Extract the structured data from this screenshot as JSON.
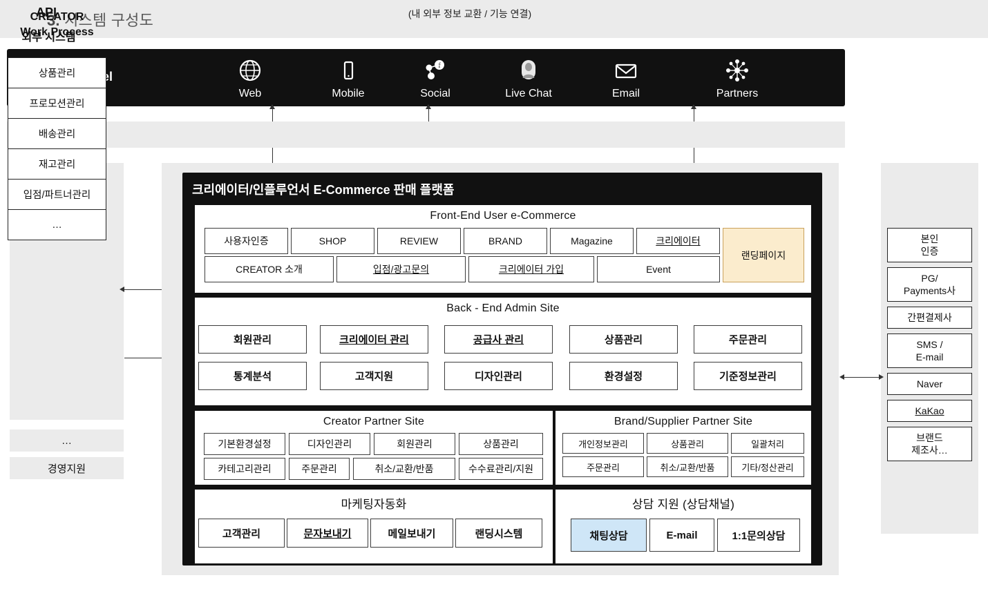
{
  "header": {
    "number": "3.",
    "title": "시스템 구성도"
  },
  "omni": {
    "label": "Omni-Channel",
    "items": [
      {
        "label": "Web",
        "icon": "globe-icon"
      },
      {
        "label": "Mobile",
        "icon": "mobile-phone-icon"
      },
      {
        "label": "Social",
        "icon": "social-network-icon"
      },
      {
        "label": "Live Chat",
        "icon": "live-chat-icon"
      },
      {
        "label": "Email",
        "icon": "envelope-icon"
      },
      {
        "label": "Partners",
        "icon": "partners-network-icon"
      }
    ]
  },
  "api": {
    "label": "API",
    "note": "(내 외부 정보 교환 /  기능 연결)"
  },
  "left_panel": {
    "title_line1": "CREATOR",
    "title_line2": "Work Process",
    "items": [
      "상품관리",
      "프로모션관리",
      "배송관리",
      "재고관리",
      "입점/파트너관리",
      "…"
    ],
    "extra1": "…",
    "extra2": "경영지원"
  },
  "right_panel": {
    "title": "외부 시스템",
    "items": [
      {
        "label": "본인\n인증",
        "underline": false,
        "tall": true
      },
      {
        "label": "PG/\nPayments사",
        "underline": false,
        "tall": true
      },
      {
        "label": "간편결제사",
        "underline": false,
        "tall": false
      },
      {
        "label": "SMS /\nE-mail",
        "underline": false,
        "tall": true
      },
      {
        "label": "Naver",
        "underline": false,
        "tall": false
      },
      {
        "label": "KaKao",
        "underline": true,
        "tall": false
      },
      {
        "label": "브랜드\n제조사…",
        "underline": false,
        "tall": true
      }
    ]
  },
  "platform": {
    "title": "크리에이터/인플루언서 E-Commerce 판매 플랫폼",
    "frontend": {
      "title": "Front-End  User e-Commerce",
      "row1": [
        {
          "label": "사용자인증",
          "underline": false,
          "highlight": "none"
        },
        {
          "label": "SHOP",
          "underline": false,
          "highlight": "none"
        },
        {
          "label": "REVIEW",
          "underline": false,
          "highlight": "none"
        },
        {
          "label": "BRAND",
          "underline": false,
          "highlight": "none"
        },
        {
          "label": "Magazine",
          "underline": false,
          "highlight": "none"
        },
        {
          "label": "크리에이터",
          "underline": true,
          "highlight": "none"
        },
        {
          "label": "랜딩페이지",
          "underline": false,
          "highlight": "yellow"
        }
      ],
      "row2": [
        {
          "label": "CREATOR 소개",
          "underline": false
        },
        {
          "label": "입점/광고문의",
          "underline": true
        },
        {
          "label": "크리에이터 가입",
          "underline": true
        },
        {
          "label": "Event",
          "underline": false
        }
      ]
    },
    "backend": {
      "title": "Back - End  Admin Site",
      "row1": [
        {
          "label": "회원관리",
          "underline": false
        },
        {
          "label": "크리에이터 관리",
          "underline": true
        },
        {
          "label": "공급사 관리",
          "underline": true
        },
        {
          "label": "상품관리",
          "underline": false
        },
        {
          "label": "주문관리",
          "underline": false
        }
      ],
      "row2": [
        {
          "label": "통계분석",
          "underline": false
        },
        {
          "label": "고객지원",
          "underline": false
        },
        {
          "label": "디자인관리",
          "underline": false
        },
        {
          "label": "환경설정",
          "underline": false
        },
        {
          "label": "기준정보관리",
          "underline": false
        }
      ]
    },
    "creator_partner": {
      "title": "Creator Partner Site",
      "row1": [
        "기본환경설정",
        "디자인관리",
        "회원관리",
        "상품관리"
      ],
      "row2": [
        "카테고리관리",
        "주문관리",
        "취소/교환/반품",
        "수수료관리/지원"
      ]
    },
    "brand_supplier": {
      "title": "Brand/Supplier  Partner Site",
      "row1": [
        "개인정보관리",
        "상품관리",
        "일괄처리"
      ],
      "row2": [
        "주문관리",
        "취소/교환/반품",
        "기타/정산관리"
      ]
    },
    "marketing": {
      "title": "마케팅자동화",
      "row1": [
        {
          "label": "고객관리",
          "underline": false
        },
        {
          "label": "문자보내기",
          "underline": true
        },
        {
          "label": "메일보내기",
          "underline": false
        },
        {
          "label": "랜딩시스템",
          "underline": false
        }
      ]
    },
    "support": {
      "title": "상담 지원 (상담채널)",
      "row1": [
        {
          "label": "채팅상담",
          "highlight": "blue"
        },
        {
          "label": "E-mail",
          "highlight": "none"
        },
        {
          "label": "1:1문의상담",
          "highlight": "none"
        }
      ]
    }
  },
  "colors": {
    "band_dark": "#111111",
    "panel_gray": "#ebebeb",
    "highlight_yellow": "#fbeccd",
    "highlight_blue": "#cfe6f7"
  }
}
